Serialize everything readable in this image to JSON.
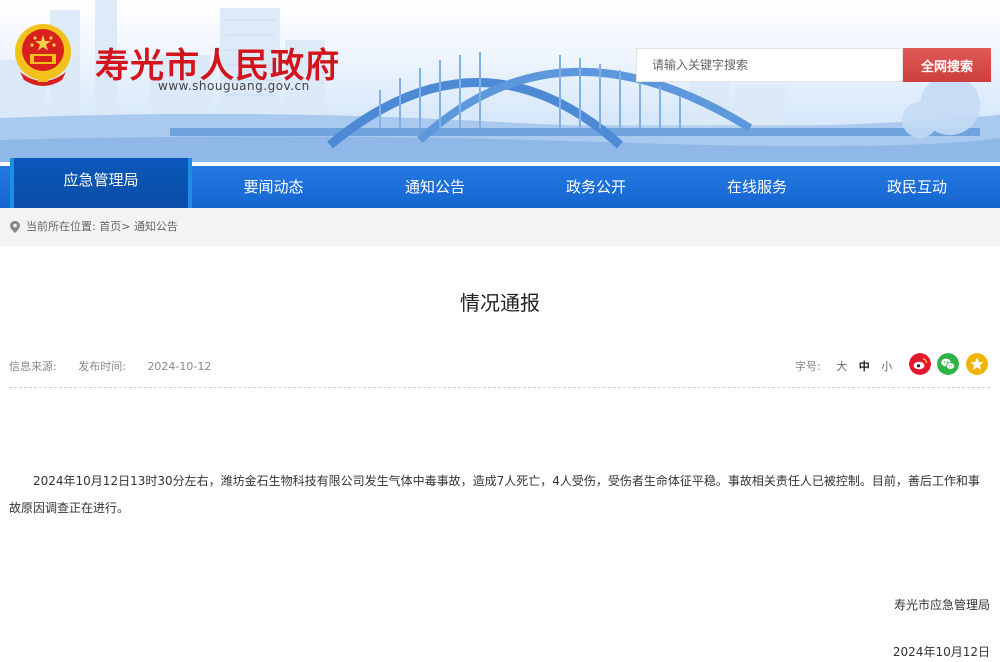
{
  "header": {
    "site_title": "寿光市人民政府",
    "site_url": "www.shouguang.gov.cn",
    "search_placeholder": "请输入关键字搜索",
    "search_button": "全网搜索"
  },
  "nav": {
    "items": [
      {
        "label": "应急管理局",
        "active": true
      },
      {
        "label": "要闻动态",
        "active": false
      },
      {
        "label": "通知公告",
        "active": false
      },
      {
        "label": "政务公开",
        "active": false
      },
      {
        "label": "在线服务",
        "active": false
      },
      {
        "label": "政民互动",
        "active": false
      }
    ]
  },
  "breadcrumb": {
    "prefix": "当前所在位置:",
    "home": "首页",
    "separator": ">",
    "current": "通知公告"
  },
  "article": {
    "title": "情况通报",
    "source_label": "信息来源:",
    "date_label": "发布时间:",
    "date_value": "2024-10-12",
    "fontsize_label": "字号:",
    "fontsize_large": "大",
    "fontsize_medium": "中",
    "fontsize_small": "小",
    "body": "2024年10月12日13时30分左右，潍坊金石生物科技有限公司发生气体中毒事故，造成7人死亡，4人受伤，受伤者生命体征平稳。事故相关责任人已被控制。目前，善后工作和事故原因调查正在进行。",
    "signature_org": "寿光市应急管理局",
    "signature_date": "2024年10月12日"
  },
  "share": {
    "icons": [
      "weibo-icon",
      "wechat-icon",
      "favorite-icon"
    ],
    "colors": [
      "#e6162d",
      "#2fb344",
      "#f2b300"
    ]
  },
  "colors": {
    "nav_blue": "#1b6fd8",
    "title_red": "#d4141c",
    "search_red": "#d9534f"
  }
}
